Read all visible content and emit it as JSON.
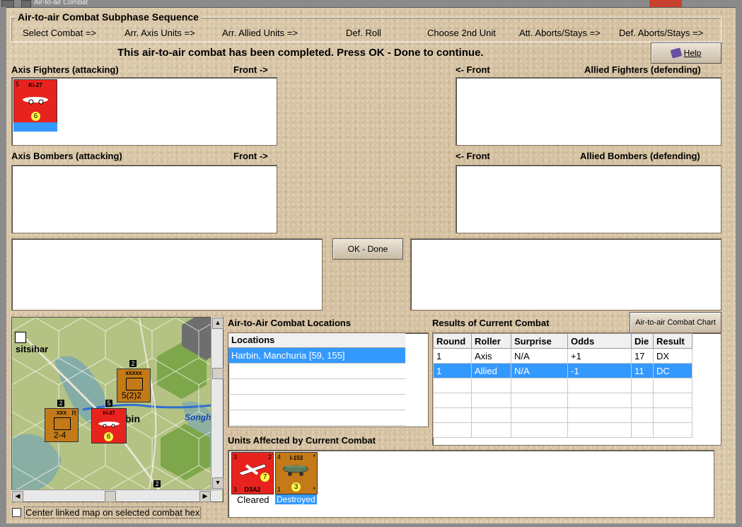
{
  "window": {
    "title": "Air-to-air Combat"
  },
  "sequence": {
    "title": "Air-to-air Combat Subphase Sequence",
    "steps": [
      "Select Combat =>",
      "Arr. Axis Units =>",
      "Arr. Allied Units =>",
      "Def. Roll",
      "Choose 2nd Unit",
      "Att. Aborts/Stays =>",
      "Def. Aborts/Stays =>"
    ]
  },
  "banner": "This air-to-air combat has been completed.  Press OK - Done to continue.",
  "help_label": "Help",
  "ok_label": "OK - Done",
  "chart_button_label": "Air-to-air Combat Chart",
  "sections": {
    "axis_fighters": "Axis Fighters (attacking)",
    "axis_bombers": "Axis Bombers (attacking)",
    "allied_fighters": "Allied Fighters (defending)",
    "allied_bombers": "Allied Bombers (defending)",
    "front_right": "Front ->",
    "front_left": "<- Front"
  },
  "axis_fighter_counter": {
    "name": "Ki-27",
    "tl": "5",
    "tr": "",
    "bl": "",
    "value": "6",
    "color": "#e8231e"
  },
  "map": {
    "labels": {
      "city1": "sitsihar",
      "city2": "bin",
      "river": "Songh"
    },
    "units": [
      {
        "top": "XXXXX",
        "value": "5(2)2",
        "stack": "2",
        "color": "#c47a18"
      },
      {
        "top": "XXX",
        "tr": "R",
        "value": "2-4",
        "stack": "2",
        "color": "#c47a18"
      },
      {
        "top": "Ki-27",
        "value": "6",
        "stack": "5",
        "color": "#e8231e"
      }
    ],
    "bottom_stack": "2"
  },
  "locations": {
    "title": "Air-to-Air Combat Locations",
    "header": "Locations",
    "rows": [
      "Harbin, Manchuria [59, 155]"
    ]
  },
  "results": {
    "title": "Results of Current Combat",
    "columns": [
      "Round",
      "Roller",
      "Surprise",
      "Odds",
      "Die",
      "Result"
    ],
    "rows": [
      [
        "1",
        "Axis",
        "N/A",
        "+1",
        "17",
        "DX"
      ],
      [
        "1",
        "Allied",
        "N/A",
        "-1",
        "11",
        "DC"
      ]
    ]
  },
  "affected": {
    "title": "Units Affected by Current Combat",
    "units": [
      {
        "name": "D3A2",
        "tl": "3",
        "tr": "2",
        "bl": "3",
        "value": "7",
        "status": "Cleared",
        "color": "#e8231e"
      },
      {
        "name": "I-153",
        "tl": "4",
        "tr": "*",
        "bl": "1",
        "br": "*",
        "value": "3",
        "status": "Destroyed",
        "color": "#c47a18"
      }
    ]
  },
  "checkbox_label": "Center linked map on selected combat hex"
}
